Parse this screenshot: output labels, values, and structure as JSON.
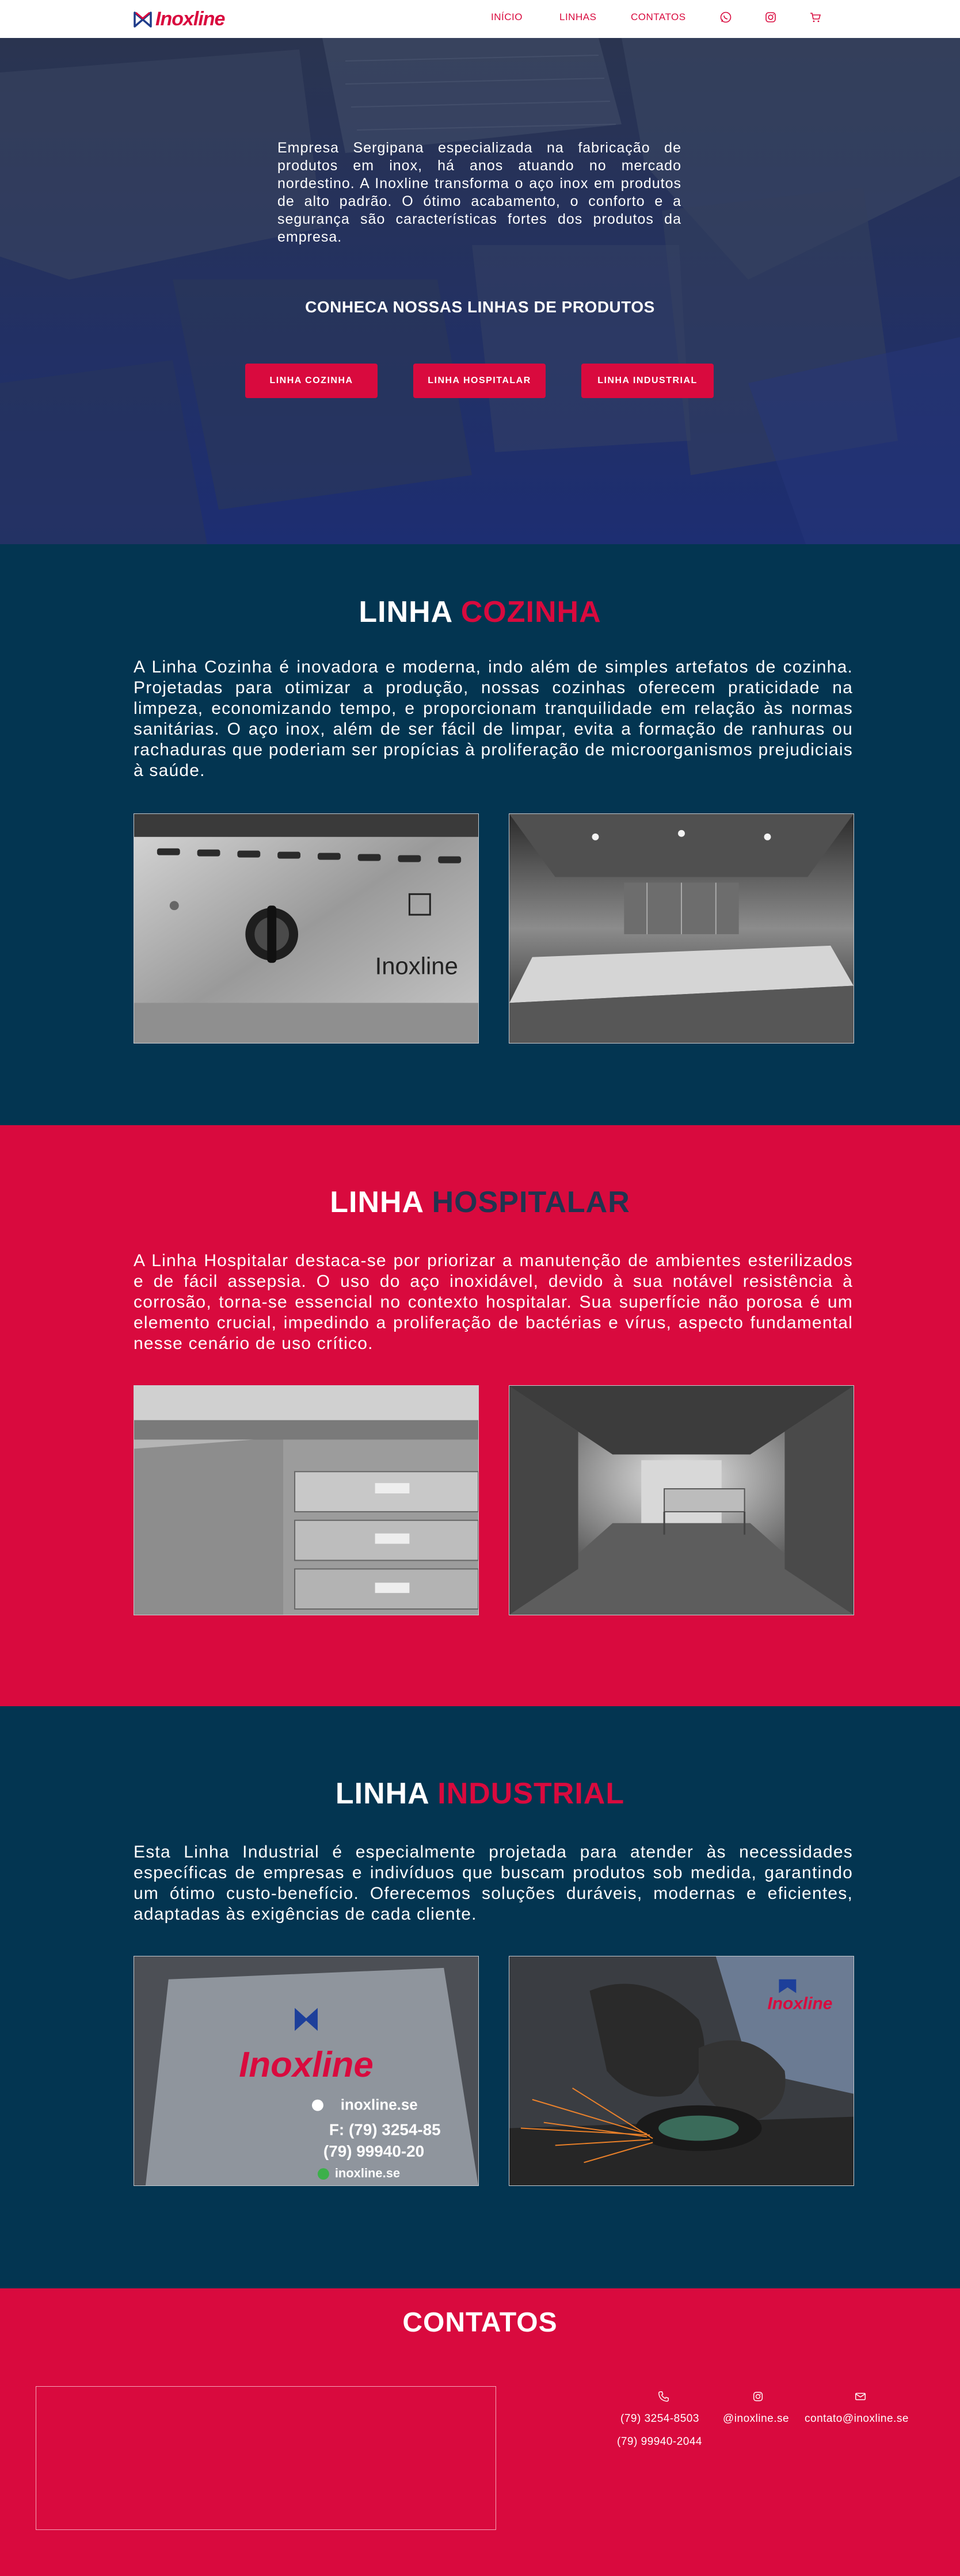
{
  "nav": {
    "logo_text": "Inoxline",
    "links": [
      "INÍCIO",
      "LINHAS",
      "CONTATOS"
    ],
    "icons": [
      "whatsapp-icon",
      "instagram-icon",
      "cart-icon"
    ]
  },
  "hero": {
    "description": "Empresa Sergipana especializada na fabricação de produtos em inox, há anos atuando no mercado nordestino. A Inoxline transforma o aço inox em produtos de alto padrão. O ótimo acabamento, o conforto e a segurança são características fortes dos produtos da empresa.",
    "subtitle": "CONHECA NOSSAS LINHAS DE PRODUTOS",
    "buttons": [
      "LINHA COZINHA",
      "LINHA HOSPITALAR",
      "LINHA INDUSTRIAL"
    ]
  },
  "cozinha": {
    "title_white": "LINHA ",
    "title_accent": "COZINHA",
    "text": "A Linha Cozinha é inovadora e moderna, indo além de simples artefatos de cozinha. Projetadas para otimizar a produção, nossas cozinhas oferecem praticidade na limpeza, economizando tempo, e proporcionam tranquilidade em relação às normas sanitárias. O aço inox, além de ser fácil de limpar, evita a formação de ranhuras ou rachaduras que poderiam ser propícias à proliferação de microorganismos prejudiciais à saúde.",
    "photo_brand": "Inoxline"
  },
  "hospitalar": {
    "title_white": "LINHA ",
    "title_accent": "HOSPITALAR",
    "text": "A Linha Hospitalar destaca-se por priorizar a manutenção de ambientes esterilizados e de fácil assepsia. O uso do aço inoxidável, devido à sua notável resistência à corrosão, torna-se essencial no contexto hospitalar. Sua superfície não porosa é um elemento crucial, impedindo a proliferação de bactérias e vírus, aspecto fundamental nesse cenário de uso crítico."
  },
  "industrial": {
    "title_white": "LINHA ",
    "title_accent": "INDUSTRIAL",
    "text": "Esta Linha Industrial é especialmente projetada para atender às necessidades específicas de empresas e indivíduos que buscam produtos sob medida, garantindo um ótimo custo-benefício. Oferecemos soluções duráveis, modernas e eficientes, adaptadas às exigências de cada cliente.",
    "shirt_brand": "Inoxline",
    "shirt_lines": [
      "inoxline.se",
      "F: (79) 3254-85",
      "(79) 99940-20",
      "inoxline.se"
    ]
  },
  "contacts": {
    "title": "CONTATOS",
    "phone1": "(79) 3254-8503",
    "phone2": "(79) 99940-2044",
    "instagram": "@inoxline.se",
    "email": "contato@inoxline.se"
  },
  "colors": {
    "brand_red": "#d90a3e",
    "navy": "#033551",
    "dark_title": "#22334f"
  }
}
